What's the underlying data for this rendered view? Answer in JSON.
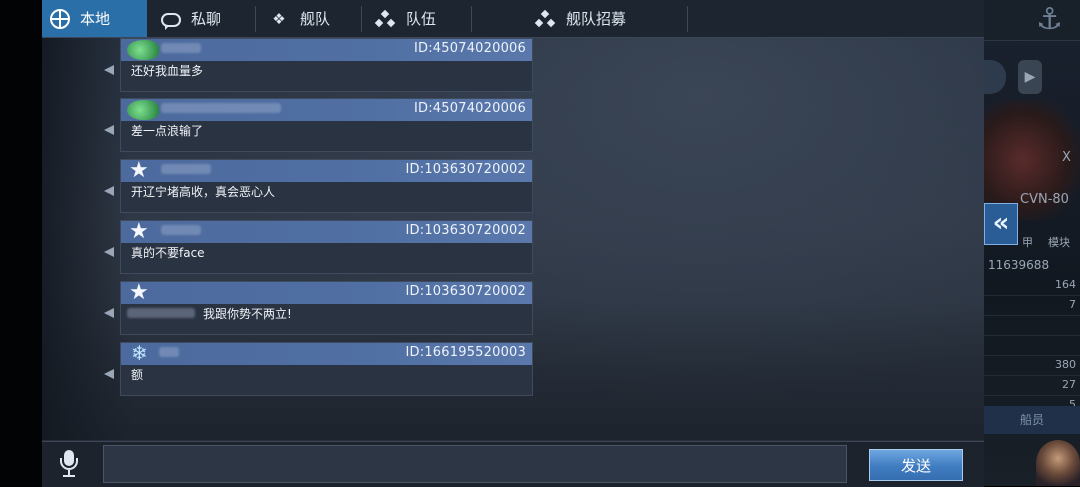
{
  "tabs": [
    {
      "label": "本地",
      "icon": "globe-icon",
      "active": true
    },
    {
      "label": "私聊",
      "icon": "chat-bubble-icon",
      "active": false
    },
    {
      "label": "舰队",
      "icon": "fleet-icon",
      "active": false
    },
    {
      "label": "队伍",
      "icon": "team-icon",
      "active": false
    },
    {
      "label": "舰队招募",
      "icon": "team-icon",
      "active": false
    }
  ],
  "messages": [
    {
      "id": "ID:45074020006",
      "text": "还好我血量多",
      "avatar": "fish-avatar-icon"
    },
    {
      "id": "ID:45074020006",
      "text": "差一点浪输了",
      "avatar": "fish-avatar-icon"
    },
    {
      "id": "ID:103630720002",
      "text": "开辽宁堵高收，真会恶心人",
      "avatar": "star-avatar-icon"
    },
    {
      "id": "ID:103630720002",
      "text": "真的不要face",
      "avatar": "star-avatar-icon"
    },
    {
      "id": "ID:103630720002",
      "text": "我跟你势不两立!",
      "avatar": "star-avatar-icon"
    },
    {
      "id": "ID:166195520003",
      "text": "额",
      "avatar": "snowflake-avatar-icon"
    }
  ],
  "input": {
    "value": "",
    "placeholder": ""
  },
  "send_label": "发送",
  "right_panel": {
    "ship_code": "CVN-80",
    "player_number": "11639688",
    "tab_a": "甲",
    "tab_b": "模块",
    "stats": [
      "164",
      "7",
      "",
      "",
      "380",
      "27",
      "5"
    ],
    "crew_button": "船员",
    "side_letter": "X"
  },
  "colors": {
    "accent": "#2b6fa8",
    "header": "#4d6a9e",
    "send": "#3f7cc0"
  }
}
